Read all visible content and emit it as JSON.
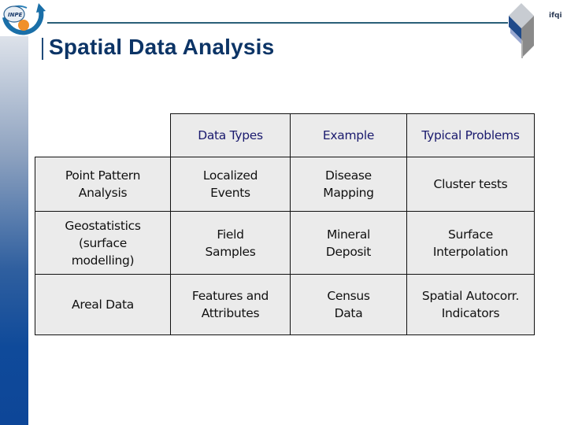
{
  "header": {
    "title": "Spatial Data Analysis",
    "logo_left": "INPE",
    "logo_right": "ifqi",
    "accent_color": "#0c3466",
    "sidebar_gradient": [
      "#dde2ea",
      "#0d4698"
    ]
  },
  "table": {
    "columns": [
      "Data Types",
      "Example",
      "Typical Problems"
    ],
    "rows": [
      {
        "label": "Point Pattern\nAnalysis",
        "cells": [
          "Localized\nEvents",
          "Disease\nMapping",
          "Cluster tests"
        ]
      },
      {
        "label": "Geostatistics\n(surface\nmodelling)",
        "cells": [
          "Field\nSamples",
          "Mineral\nDeposit",
          "Surface\nInterpolation"
        ]
      },
      {
        "label": "Areal Data",
        "cells": [
          "Features and\nAttributes",
          "Census\nData",
          "Spatial Autocorr.\nIndicators"
        ]
      }
    ]
  }
}
